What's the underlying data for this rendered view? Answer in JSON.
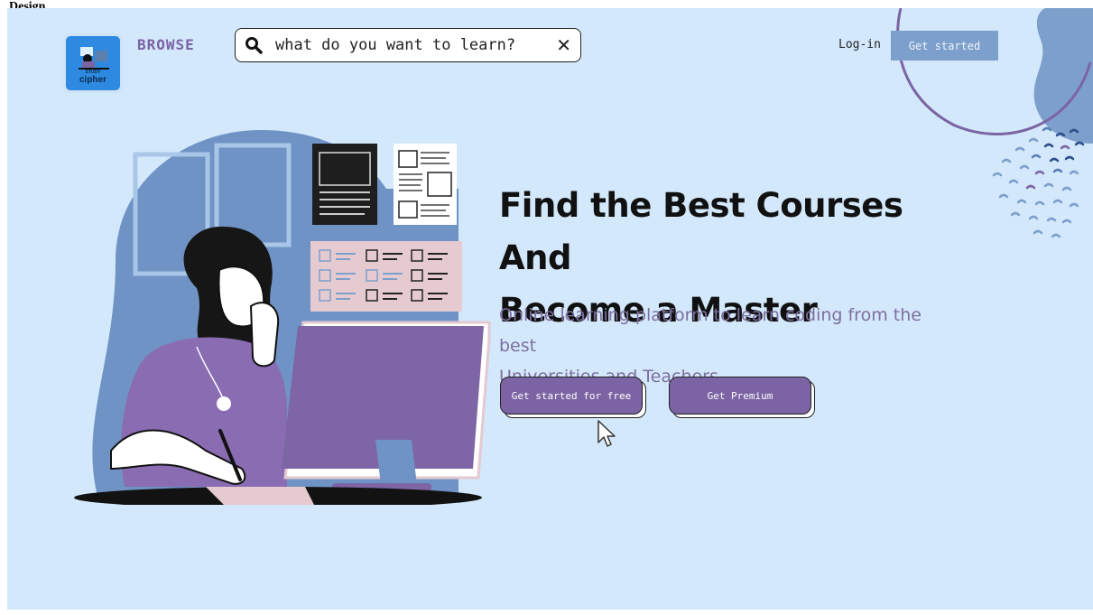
{
  "document": {
    "header_text": "Design"
  },
  "nav": {
    "logo_line1": "STUDY",
    "logo_line2": "cipher",
    "browse_label": "BROWSE",
    "search_placeholder": "what do you want to learn?",
    "search_icon": "search-icon",
    "clear_icon": "close-icon",
    "login_label": "Log-in",
    "get_started_label": "Get started"
  },
  "hero": {
    "title_line1": "Find the Best Courses And",
    "title_line2": "Become a Master",
    "subtitle_line1": "Online learning platform to learn coding from the best",
    "subtitle_line2": "Universities and Teachers",
    "primary_button": "Get started for free",
    "secondary_button": "Get Premium"
  },
  "colors": {
    "background": "#d3e8fb",
    "accent_purple": "#7c64a4",
    "accent_blue": "#7d9fcc",
    "text_dark": "#111111",
    "subtitle_purple": "#7d6fa0"
  }
}
